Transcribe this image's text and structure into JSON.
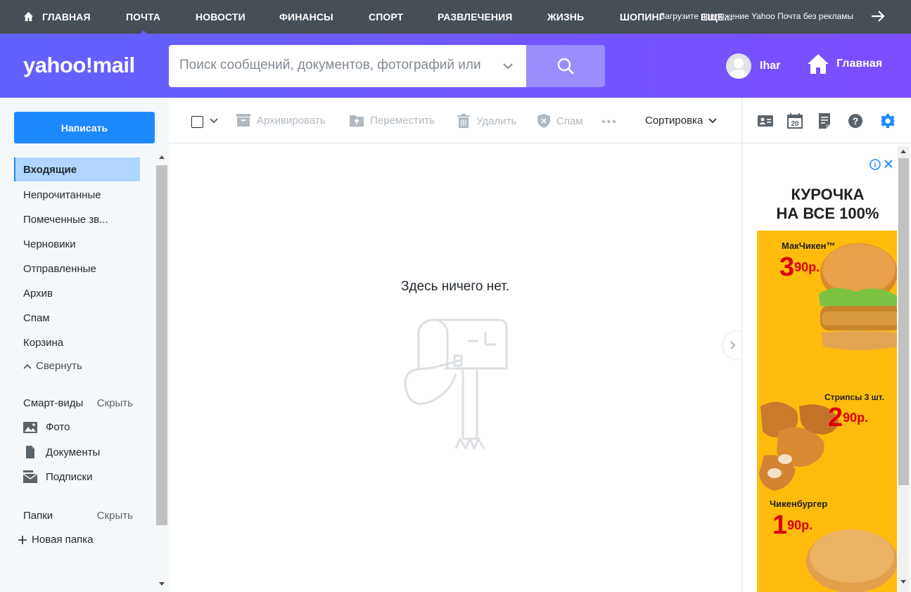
{
  "topnav": {
    "items": [
      "ГЛАВНАЯ",
      "ПОЧТА",
      "НОВОСТИ",
      "ФИНАНСЫ",
      "СПОРТ",
      "РАЗВЛЕЧЕНИЯ",
      "ЖИЗНЬ",
      "ШОПИНГ",
      "ЕЩЕ..."
    ],
    "active": "ПОЧТА",
    "promo": "Загрузите приложение Yahoo Почта без рекламы"
  },
  "header": {
    "logo": "yahoo!mail",
    "search_placeholder": "Поиск сообщений, документов, фотографий или",
    "user_name": "Ihar",
    "home_label": "Главная"
  },
  "sidebar": {
    "compose_label": "Написать",
    "folders": [
      "Входящие",
      "Непрочитанные",
      "Помеченные зв...",
      "Черновики",
      "Отправленные",
      "Архив",
      "Спам",
      "Корзина"
    ],
    "active_folder": "Входящие",
    "collapse_label": "Свернуть",
    "smart_views_label": "Смарт-виды",
    "smart_hide": "Скрыть",
    "smart_items": [
      "Фото",
      "Документы",
      "Подписки"
    ],
    "folders_label": "Папки",
    "folders_hide": "Скрыть",
    "new_folder": "Новая папка"
  },
  "toolbar": {
    "archive": "Архивировать",
    "move": "Переместить",
    "delete": "Удалить",
    "spam": "Спам",
    "sort": "Сортировка"
  },
  "main": {
    "empty_message": "Здесь ничего нет."
  },
  "ad": {
    "headline_1": "КУРОЧКА",
    "headline_2": "НА ВСЕ 100%",
    "items": [
      {
        "name": "МакЧикен™",
        "price_main": "3",
        "price_sup": "90р."
      },
      {
        "name": "Стрипсы 3 шт.",
        "price_main": "2",
        "price_sup": "90р."
      },
      {
        "name": "Чикенбургер",
        "price_main": "1",
        "price_sup": "90р."
      }
    ]
  },
  "colors": {
    "header_gradient_start": "#6161ff",
    "header_gradient_end": "#7b4dff",
    "compose_blue": "#1d89ff",
    "active_folder_bg": "#b0d6ff",
    "ad_yellow": "#ffbc0d",
    "ad_red": "#db0007"
  }
}
